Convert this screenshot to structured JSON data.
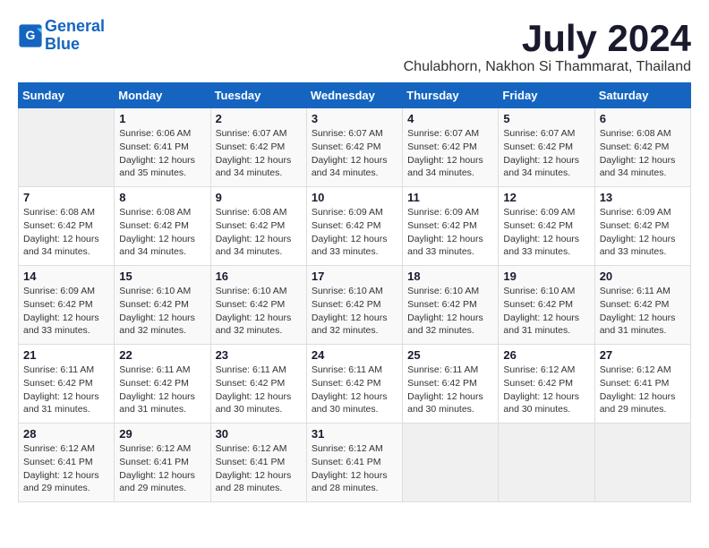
{
  "logo": {
    "line1": "General",
    "line2": "Blue"
  },
  "title": "July 2024",
  "subtitle": "Chulabhorn, Nakhon Si Thammarat, Thailand",
  "header": {
    "days": [
      "Sunday",
      "Monday",
      "Tuesday",
      "Wednesday",
      "Thursday",
      "Friday",
      "Saturday"
    ]
  },
  "weeks": [
    {
      "cells": [
        {
          "day": "",
          "info": ""
        },
        {
          "day": "1",
          "info": "Sunrise: 6:06 AM\nSunset: 6:41 PM\nDaylight: 12 hours\nand 35 minutes."
        },
        {
          "day": "2",
          "info": "Sunrise: 6:07 AM\nSunset: 6:42 PM\nDaylight: 12 hours\nand 34 minutes."
        },
        {
          "day": "3",
          "info": "Sunrise: 6:07 AM\nSunset: 6:42 PM\nDaylight: 12 hours\nand 34 minutes."
        },
        {
          "day": "4",
          "info": "Sunrise: 6:07 AM\nSunset: 6:42 PM\nDaylight: 12 hours\nand 34 minutes."
        },
        {
          "day": "5",
          "info": "Sunrise: 6:07 AM\nSunset: 6:42 PM\nDaylight: 12 hours\nand 34 minutes."
        },
        {
          "day": "6",
          "info": "Sunrise: 6:08 AM\nSunset: 6:42 PM\nDaylight: 12 hours\nand 34 minutes."
        }
      ]
    },
    {
      "cells": [
        {
          "day": "7",
          "info": "Sunrise: 6:08 AM\nSunset: 6:42 PM\nDaylight: 12 hours\nand 34 minutes."
        },
        {
          "day": "8",
          "info": "Sunrise: 6:08 AM\nSunset: 6:42 PM\nDaylight: 12 hours\nand 34 minutes."
        },
        {
          "day": "9",
          "info": "Sunrise: 6:08 AM\nSunset: 6:42 PM\nDaylight: 12 hours\nand 34 minutes."
        },
        {
          "day": "10",
          "info": "Sunrise: 6:09 AM\nSunset: 6:42 PM\nDaylight: 12 hours\nand 33 minutes."
        },
        {
          "day": "11",
          "info": "Sunrise: 6:09 AM\nSunset: 6:42 PM\nDaylight: 12 hours\nand 33 minutes."
        },
        {
          "day": "12",
          "info": "Sunrise: 6:09 AM\nSunset: 6:42 PM\nDaylight: 12 hours\nand 33 minutes."
        },
        {
          "day": "13",
          "info": "Sunrise: 6:09 AM\nSunset: 6:42 PM\nDaylight: 12 hours\nand 33 minutes."
        }
      ]
    },
    {
      "cells": [
        {
          "day": "14",
          "info": "Sunrise: 6:09 AM\nSunset: 6:42 PM\nDaylight: 12 hours\nand 33 minutes."
        },
        {
          "day": "15",
          "info": "Sunrise: 6:10 AM\nSunset: 6:42 PM\nDaylight: 12 hours\nand 32 minutes."
        },
        {
          "day": "16",
          "info": "Sunrise: 6:10 AM\nSunset: 6:42 PM\nDaylight: 12 hours\nand 32 minutes."
        },
        {
          "day": "17",
          "info": "Sunrise: 6:10 AM\nSunset: 6:42 PM\nDaylight: 12 hours\nand 32 minutes."
        },
        {
          "day": "18",
          "info": "Sunrise: 6:10 AM\nSunset: 6:42 PM\nDaylight: 12 hours\nand 32 minutes."
        },
        {
          "day": "19",
          "info": "Sunrise: 6:10 AM\nSunset: 6:42 PM\nDaylight: 12 hours\nand 31 minutes."
        },
        {
          "day": "20",
          "info": "Sunrise: 6:11 AM\nSunset: 6:42 PM\nDaylight: 12 hours\nand 31 minutes."
        }
      ]
    },
    {
      "cells": [
        {
          "day": "21",
          "info": "Sunrise: 6:11 AM\nSunset: 6:42 PM\nDaylight: 12 hours\nand 31 minutes."
        },
        {
          "day": "22",
          "info": "Sunrise: 6:11 AM\nSunset: 6:42 PM\nDaylight: 12 hours\nand 31 minutes."
        },
        {
          "day": "23",
          "info": "Sunrise: 6:11 AM\nSunset: 6:42 PM\nDaylight: 12 hours\nand 30 minutes."
        },
        {
          "day": "24",
          "info": "Sunrise: 6:11 AM\nSunset: 6:42 PM\nDaylight: 12 hours\nand 30 minutes."
        },
        {
          "day": "25",
          "info": "Sunrise: 6:11 AM\nSunset: 6:42 PM\nDaylight: 12 hours\nand 30 minutes."
        },
        {
          "day": "26",
          "info": "Sunrise: 6:12 AM\nSunset: 6:42 PM\nDaylight: 12 hours\nand 30 minutes."
        },
        {
          "day": "27",
          "info": "Sunrise: 6:12 AM\nSunset: 6:41 PM\nDaylight: 12 hours\nand 29 minutes."
        }
      ]
    },
    {
      "cells": [
        {
          "day": "28",
          "info": "Sunrise: 6:12 AM\nSunset: 6:41 PM\nDaylight: 12 hours\nand 29 minutes."
        },
        {
          "day": "29",
          "info": "Sunrise: 6:12 AM\nSunset: 6:41 PM\nDaylight: 12 hours\nand 29 minutes."
        },
        {
          "day": "30",
          "info": "Sunrise: 6:12 AM\nSunset: 6:41 PM\nDaylight: 12 hours\nand 28 minutes."
        },
        {
          "day": "31",
          "info": "Sunrise: 6:12 AM\nSunset: 6:41 PM\nDaylight: 12 hours\nand 28 minutes."
        },
        {
          "day": "",
          "info": ""
        },
        {
          "day": "",
          "info": ""
        },
        {
          "day": "",
          "info": ""
        }
      ]
    }
  ]
}
